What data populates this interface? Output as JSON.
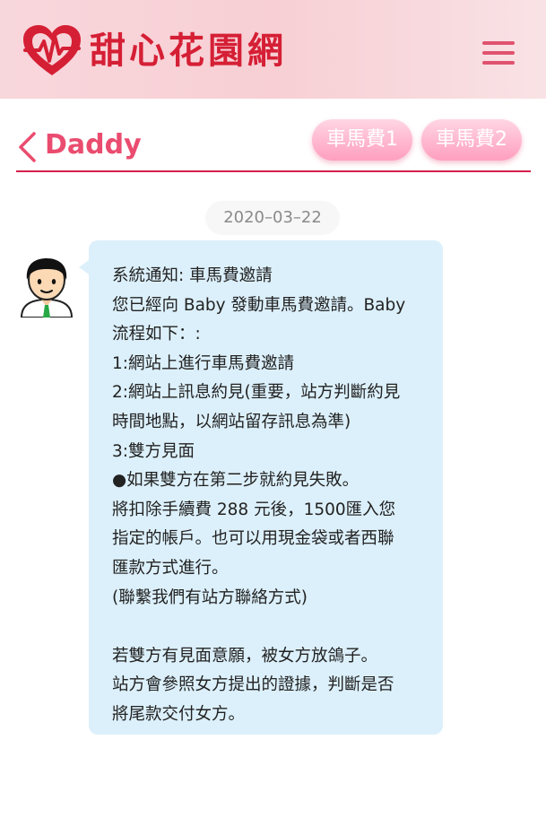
{
  "header": {
    "site_name": "甜心花園網",
    "logo_icon": "heart-pulse-icon",
    "menu_icon": "hamburger-menu-icon",
    "brand_color": "#d51f35"
  },
  "chat": {
    "partner_name": "Daddy",
    "back_icon": "chevron-left-icon",
    "tabs": [
      {
        "label": "車馬費1"
      },
      {
        "label": "車馬費2"
      }
    ]
  },
  "messages": [
    {
      "date": "2020–03–22",
      "avatar_icon": "man-avatar-icon",
      "lines": [
        "系統通知: 車馬費邀請",
        "您已經向 Baby 發動車馬費邀請。Baby",
        "流程如下：:",
        "1:網站上進行車馬費邀請",
        "2:網站上訊息約見(重要，站方判斷約見",
        "時間地點，以網站留存訊息為準)",
        "3:雙方見面",
        "●如果雙方在第二步就約見失敗。",
        "將扣除手續費 288 元後，1500匯入您",
        "指定的帳戶。也可以用現金袋或者西聯",
        "匯款方式進行。",
        "(聯繫我們有站方聯絡方式)",
        "",
        "若雙方有見面意願，被女方放鴿子。",
        "站方會參照女方提出的證據，判斷是否",
        "將尾款交付女方。"
      ]
    }
  ]
}
